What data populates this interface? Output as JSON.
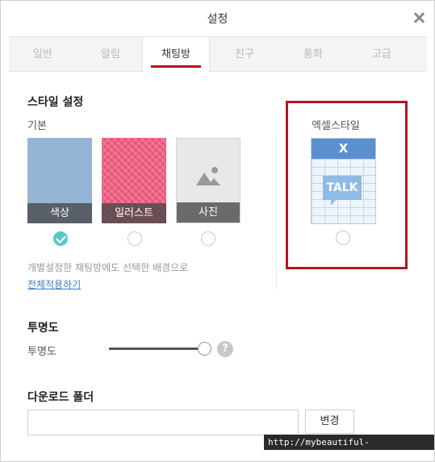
{
  "window": {
    "title": "설정"
  },
  "tabs": [
    {
      "label": "일반"
    },
    {
      "label": "알림"
    },
    {
      "label": "채팅방"
    },
    {
      "label": "친구"
    },
    {
      "label": "통화"
    },
    {
      "label": "고급"
    }
  ],
  "active_tab": "채팅방",
  "style": {
    "section_title": "스타일 설정",
    "basic_label": "기본",
    "options": [
      {
        "label": "색상",
        "selected": true
      },
      {
        "label": "일러스트",
        "selected": false
      },
      {
        "label": "사진",
        "selected": false
      }
    ],
    "excel": {
      "label": "엑셀스타일",
      "header_text": "X",
      "bubble_text": "TALK",
      "selected": false
    },
    "note": "개별설정한 채팅방에도 선택한 배경으로",
    "apply_all_link": "전체적용하기"
  },
  "opacity": {
    "section_title": "투명도",
    "label": "투명도",
    "level_percent": 100,
    "help_icon": "?"
  },
  "download": {
    "section_title": "다운로드 폴더",
    "path_value": "",
    "change_button": "변경"
  },
  "watermark": "http://mybeautiful-life.tistory.com",
  "colors": {
    "accent": "#b3141d",
    "check": "#5ac8c6",
    "link": "#3b7cc5",
    "color_card": "#96b4d6",
    "illust_card": "#ee6282",
    "excel_header": "#5b8fd0"
  }
}
